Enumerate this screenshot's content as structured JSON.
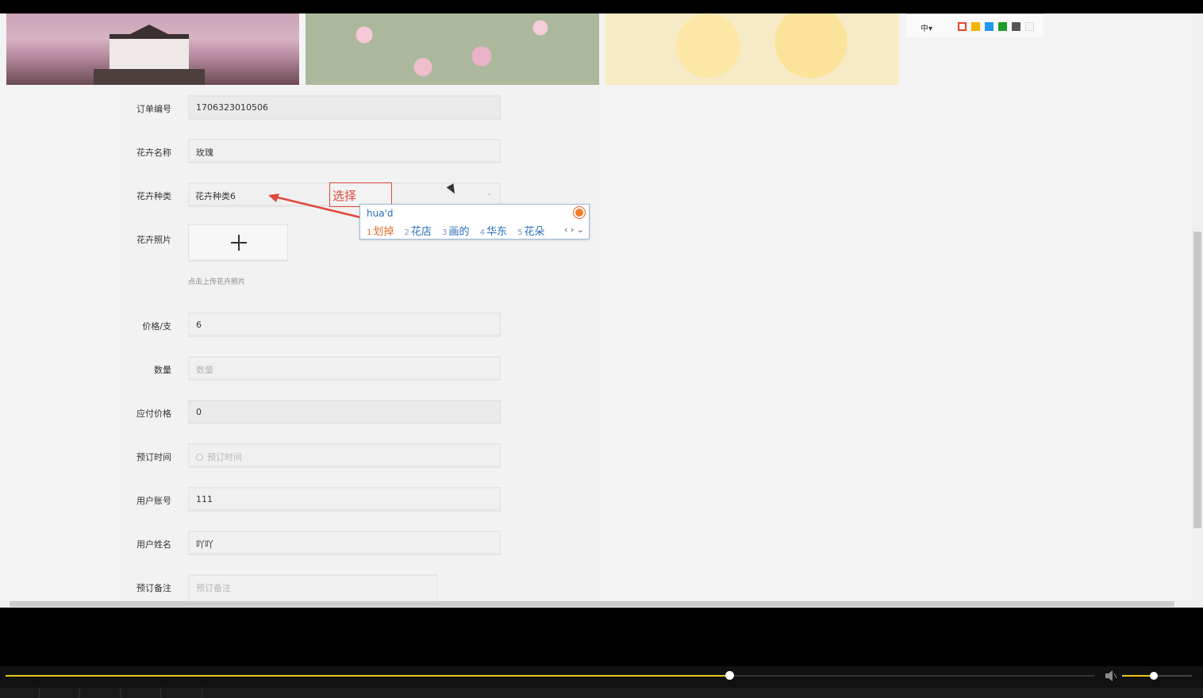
{
  "toolbar": {
    "lang_label": "中▾",
    "swatches": [
      "#e8442e",
      "#f4b400",
      "#2196f3",
      "#1a9c2a",
      "#555555",
      "#f5f5f5"
    ]
  },
  "form": {
    "order_no": {
      "label": "订单编号",
      "value": "1706323010506"
    },
    "flower_name": {
      "label": "花卉名称",
      "value": "玫瑰"
    },
    "flower_type": {
      "label": "花卉种类",
      "value": "花卉种类6"
    },
    "flower_photo": {
      "label": "花卉照片",
      "hint": "点击上传花卉照片"
    },
    "price": {
      "label": "价格/支",
      "value": "6"
    },
    "quantity": {
      "label": "数量",
      "placeholder": "数量"
    },
    "payable": {
      "label": "应付价格",
      "value": "0"
    },
    "reserve_time": {
      "label": "预订时间",
      "placeholder": "预订时间"
    },
    "user_account": {
      "label": "用户账号",
      "value": "111"
    },
    "user_name": {
      "label": "用户姓名",
      "value": "吖吖"
    },
    "remark": {
      "label": "预订备注",
      "placeholder": "预订备注"
    }
  },
  "annotation": {
    "text": "选择"
  },
  "ime": {
    "pinyin": "hua'd",
    "candidates": [
      {
        "n": "1",
        "text": "划掉"
      },
      {
        "n": "2",
        "text": "花店"
      },
      {
        "n": "3",
        "text": "画的"
      },
      {
        "n": "4",
        "text": "华东"
      },
      {
        "n": "5",
        "text": "花朵"
      }
    ],
    "nav": "‹ › ⌄"
  },
  "player": {
    "progress": 0.665,
    "volume": 0.45
  }
}
